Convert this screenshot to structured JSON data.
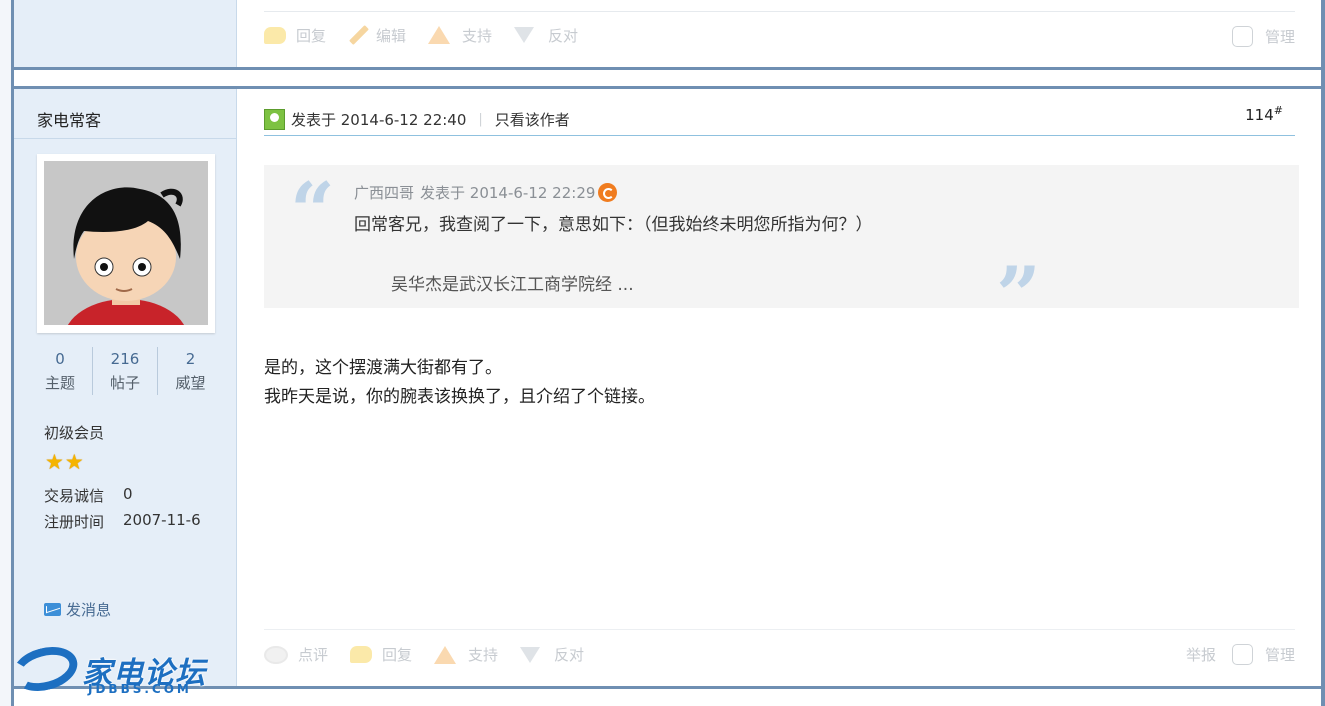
{
  "prev_post": {
    "actions": [
      {
        "label": "回复",
        "icon": "reply-bubble-icon"
      },
      {
        "label": "编辑",
        "icon": "pencil-icon"
      },
      {
        "label": "支持",
        "icon": "thumb-up-arrow-icon"
      },
      {
        "label": "反对",
        "icon": "thumb-down-arrow-icon"
      }
    ],
    "manage_label": "管理"
  },
  "author": {
    "name": "家电常客",
    "stats": [
      {
        "value": "0",
        "label": "主题"
      },
      {
        "value": "216",
        "label": "帖子"
      },
      {
        "value": "2",
        "label": "威望"
      }
    ],
    "rank": "初级会员",
    "stars": 2,
    "trade_label": "交易诚信",
    "trade_value": "0",
    "reg_label": "注册时间",
    "reg_value": "2007-11-6",
    "send_msg": "发消息"
  },
  "post": {
    "posted_at": "发表于 2014-6-12 22:40",
    "only_author": "只看该作者",
    "floor": "114",
    "floor_mark": "#",
    "quote": {
      "author": "广西四哥",
      "meta": "发表于 2014-6-12 22:29",
      "line": "回常客兄，我查阅了一下，意思如下：（但我始终未明您所指为何？）",
      "sub": "吴华杰是武汉长江工商学院经 ..."
    },
    "body": [
      "是的，这个摆渡满大街都有了。",
      "我昨天是说，你的腕表该换换了，且介绍了个链接。"
    ],
    "actions": [
      {
        "label": "点评",
        "icon": "comment-eye-icon"
      },
      {
        "label": "回复",
        "icon": "reply-bubble-icon"
      },
      {
        "label": "支持",
        "icon": "thumb-up-arrow-icon"
      },
      {
        "label": "反对",
        "icon": "thumb-down-arrow-icon"
      }
    ],
    "report_label": "举报",
    "manage_label": "管理"
  },
  "watermark": {
    "text": "家电论坛",
    "sub": "JDBBS.COM"
  },
  "colors": {
    "border": "#6f8fb2",
    "sidebar": "#e5eef8",
    "link": "#466a92",
    "watermark": "#1d6fc1"
  }
}
